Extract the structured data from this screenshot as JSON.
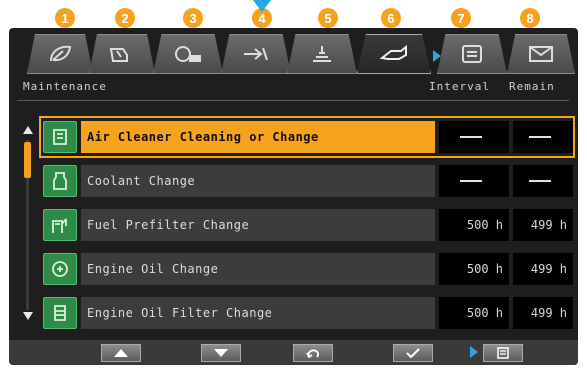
{
  "callouts": [
    "1",
    "2",
    "3",
    "4",
    "5",
    "6",
    "7",
    "8"
  ],
  "tabs": [
    {
      "icon": "leaf-eco-icon"
    },
    {
      "icon": "machine-scoop-icon"
    },
    {
      "icon": "gauge-card-icon"
    },
    {
      "icon": "attachment-flow-icon"
    },
    {
      "icon": "hydraulic-machine-icon"
    },
    {
      "icon": "maintenance-wrench-icon",
      "active": true
    },
    {
      "icon": "document-list-icon"
    },
    {
      "icon": "envelope-mail-icon"
    }
  ],
  "header": {
    "title": "Maintenance",
    "interval": "Interval",
    "remain": "Remain"
  },
  "rows": [
    {
      "name": "Air Cleaner Cleaning or Change",
      "interval": "",
      "remain": "",
      "icon": "air-filter-icon",
      "selected": true
    },
    {
      "name": "Coolant Change",
      "interval": "",
      "remain": "",
      "icon": "coolant-icon"
    },
    {
      "name": "Fuel Prefilter Change",
      "interval": "500 h",
      "remain": "499 h",
      "icon": "fuel-prefilter-icon"
    },
    {
      "name": "Engine Oil Change",
      "interval": "500 h",
      "remain": "499 h",
      "icon": "engine-oil-icon"
    },
    {
      "name": "Engine Oil Filter Change",
      "interval": "500 h",
      "remain": "499 h",
      "icon": "oil-filter-icon"
    }
  ],
  "bottom": {
    "buttons": [
      {
        "name": "page-up-button",
        "icon": "triangle-up-icon"
      },
      {
        "name": "page-down-button",
        "icon": "triangle-down-icon"
      },
      {
        "name": "back-button",
        "icon": "return-arrow-icon"
      },
      {
        "name": "confirm-button",
        "icon": "checkmark-icon"
      },
      {
        "name": "list-button",
        "icon": "list-icon"
      }
    ]
  },
  "colors": {
    "accent": "#f5a21d",
    "selection_pointer": "#26a9e0",
    "icon_green": "#2e8b4a",
    "row_bg": "#3c3c3c",
    "value_bg": "#000000"
  }
}
